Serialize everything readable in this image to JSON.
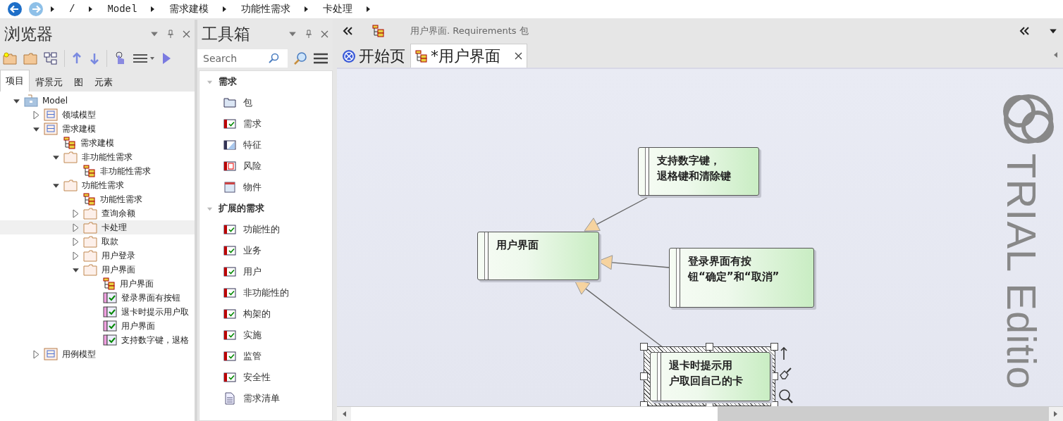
{
  "breadcrumb": [
    "/",
    "Model",
    "需求建模",
    "功能性需求",
    "卡处理"
  ],
  "browser": {
    "title": "浏览器",
    "tabs": [
      {
        "label": "项目",
        "selected": true
      },
      {
        "label": "背景元",
        "selected": false
      },
      {
        "label": "图",
        "selected": false
      },
      {
        "label": "元素",
        "selected": false
      }
    ],
    "tree": [
      {
        "label": "Model",
        "kind": "model",
        "expanded": true,
        "selected": false,
        "children": [
          {
            "label": "领域模型",
            "kind": "package",
            "expanded": false,
            "selected": false
          },
          {
            "label": "需求建模",
            "kind": "package",
            "expanded": true,
            "selected": false,
            "children": [
              {
                "label": "需求建模",
                "kind": "diagram",
                "selected": false
              },
              {
                "label": "非功能性需求",
                "kind": "folder",
                "expanded": true,
                "selected": false,
                "children": [
                  {
                    "label": "非功能性需求",
                    "kind": "diagram",
                    "selected": false
                  }
                ]
              },
              {
                "label": "功能性需求",
                "kind": "folder",
                "expanded": true,
                "selected": false,
                "children": [
                  {
                    "label": "功能性需求",
                    "kind": "diagram",
                    "selected": false
                  },
                  {
                    "label": "查询余额",
                    "kind": "folder",
                    "expanded": false,
                    "selected": false
                  },
                  {
                    "label": "卡处理",
                    "kind": "folder",
                    "expanded": false,
                    "selected": true
                  },
                  {
                    "label": "取款",
                    "kind": "folder",
                    "expanded": false,
                    "selected": false
                  },
                  {
                    "label": "用户登录",
                    "kind": "folder",
                    "expanded": false,
                    "selected": false
                  },
                  {
                    "label": "用户界面",
                    "kind": "folder",
                    "expanded": true,
                    "selected": false,
                    "children": [
                      {
                        "label": "用户界面",
                        "kind": "diagram",
                        "selected": false
                      },
                      {
                        "label": "登录界面有按钮",
                        "kind": "requirement",
                        "selected": false
                      },
                      {
                        "label": "退卡时提示用户取",
                        "kind": "requirement",
                        "selected": false
                      },
                      {
                        "label": "用户界面",
                        "kind": "requirement",
                        "selected": false
                      },
                      {
                        "label": "支持数字键，退格",
                        "kind": "requirement",
                        "selected": false
                      }
                    ]
                  }
                ]
              }
            ]
          },
          {
            "label": "用例模型",
            "kind": "package",
            "expanded": false,
            "selected": false
          }
        ]
      }
    ]
  },
  "toolbox": {
    "title": "工具箱",
    "search": {
      "placeholder": "Search"
    },
    "groups": [
      {
        "title": "需求",
        "expanded": true,
        "items": [
          {
            "label": "包",
            "kind": "package"
          },
          {
            "label": "需求",
            "kind": "requirement"
          },
          {
            "label": "特征",
            "kind": "feature"
          },
          {
            "label": "风险",
            "kind": "risk"
          },
          {
            "label": "物件",
            "kind": "artifact"
          }
        ]
      },
      {
        "title": "扩展的需求",
        "expanded": true,
        "items": [
          {
            "label": "功能性的",
            "kind": "requirement"
          },
          {
            "label": "业务",
            "kind": "requirement"
          },
          {
            "label": "用户",
            "kind": "requirement"
          },
          {
            "label": "非功能性的",
            "kind": "requirement"
          },
          {
            "label": "构架的",
            "kind": "requirement"
          },
          {
            "label": "实施",
            "kind": "requirement"
          },
          {
            "label": "监管",
            "kind": "requirement"
          },
          {
            "label": "安全性",
            "kind": "requirement"
          },
          {
            "label": "需求清单",
            "kind": "document"
          }
        ]
      }
    ]
  },
  "diagram": {
    "header": "用户界面. Requirements 包",
    "tabs": [
      {
        "label": "开始页",
        "kind": "start",
        "selected": false
      },
      {
        "label": "*用户界面",
        "kind": "diagram",
        "selected": true
      }
    ],
    "nodes": [
      {
        "text": "支持数字键，退格键和清除键",
        "selected": false
      },
      {
        "text": "用户界面",
        "selected": false
      },
      {
        "text": "登录界面有按钮“确定”和“取消”",
        "selected": false
      },
      {
        "text": "退卡时提示用户取回自己的卡",
        "selected": true
      }
    ],
    "watermark": "TRIAL Editio"
  }
}
